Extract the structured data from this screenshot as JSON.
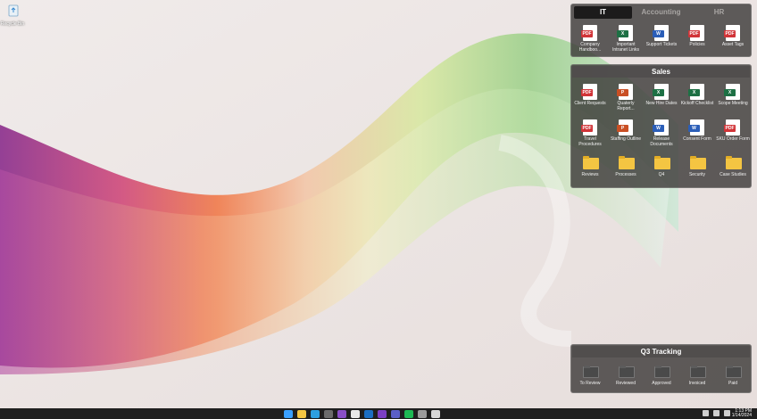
{
  "desktop": {
    "recycle_bin_label": "Recycle Bin"
  },
  "fence_it": {
    "tabs": [
      {
        "label": "IT",
        "active": true
      },
      {
        "label": "Accounting",
        "active": false
      },
      {
        "label": "HR",
        "active": false
      }
    ],
    "items": [
      {
        "label": "Company Handboo...",
        "type": "pdf",
        "icon": "pdf-icon"
      },
      {
        "label": "Important Intranet Links",
        "type": "xls",
        "icon": "excel-icon"
      },
      {
        "label": "Support Tickets",
        "type": "doc",
        "icon": "word-icon"
      },
      {
        "label": "Policies",
        "type": "pdf",
        "icon": "pdf-icon"
      },
      {
        "label": "Asset Tags",
        "type": "pdf",
        "icon": "pdf-icon"
      }
    ]
  },
  "fence_sales": {
    "title": "Sales",
    "items": [
      {
        "label": "Client Requests",
        "type": "pdf",
        "icon": "pdf-icon"
      },
      {
        "label": "Quaterly Report...",
        "type": "ppt",
        "icon": "powerpoint-icon"
      },
      {
        "label": "New Hire Dates",
        "type": "xls",
        "icon": "excel-icon"
      },
      {
        "label": "Kickoff Checklist",
        "type": "xls",
        "icon": "excel-icon"
      },
      {
        "label": "Scope Meeting",
        "type": "xls",
        "icon": "excel-icon"
      },
      {
        "label": "Travel Procedures",
        "type": "pdf",
        "icon": "pdf-icon"
      },
      {
        "label": "Staffing Outline",
        "type": "ppt",
        "icon": "powerpoint-icon"
      },
      {
        "label": "Release Documents",
        "type": "doc",
        "icon": "word-icon"
      },
      {
        "label": "Consent Form",
        "type": "doc",
        "icon": "word-icon"
      },
      {
        "label": "SKU Order Form",
        "type": "pdf",
        "icon": "pdf-icon"
      },
      {
        "label": "Reviews",
        "type": "folder",
        "icon": "folder-icon"
      },
      {
        "label": "Processes",
        "type": "folder",
        "icon": "folder-icon"
      },
      {
        "label": "Q4",
        "type": "folder",
        "icon": "folder-icon"
      },
      {
        "label": "Security",
        "type": "folder",
        "icon": "folder-icon"
      },
      {
        "label": "Case Studies",
        "type": "folder",
        "icon": "folder-icon"
      }
    ]
  },
  "fence_q3": {
    "title": "Q3 Tracking",
    "items": [
      {
        "label": "To Review",
        "type": "folder-dark",
        "icon": "folder-icon"
      },
      {
        "label": "Reviewed",
        "type": "folder-dark",
        "icon": "folder-icon"
      },
      {
        "label": "Approved",
        "type": "folder-dark",
        "icon": "folder-icon"
      },
      {
        "label": "Invoiced",
        "type": "folder-dark",
        "icon": "folder-icon"
      },
      {
        "label": "Paid",
        "type": "folder-dark",
        "icon": "folder-icon"
      }
    ]
  },
  "taskbar": {
    "apps": [
      {
        "name": "start-icon",
        "color": "#3aa0ff"
      },
      {
        "name": "file-explorer-icon",
        "color": "#f4c542"
      },
      {
        "name": "edge-icon",
        "color": "#2d9fe0"
      },
      {
        "name": "settings-icon",
        "color": "#6b6b6b"
      },
      {
        "name": "onenote-icon",
        "color": "#8a4fc7"
      },
      {
        "name": "notion-icon",
        "color": "#e8e8e8"
      },
      {
        "name": "outlook-icon",
        "color": "#1b6ec2"
      },
      {
        "name": "video-icon",
        "color": "#7b3fc4"
      },
      {
        "name": "teams-icon",
        "color": "#5b5fc7"
      },
      {
        "name": "spotify-icon",
        "color": "#1db954"
      },
      {
        "name": "gear-icon",
        "color": "#9b9b9b"
      },
      {
        "name": "fences-icon",
        "color": "#d8d8d8"
      }
    ],
    "time": "1:13 PM",
    "date": "1/14/2024"
  }
}
